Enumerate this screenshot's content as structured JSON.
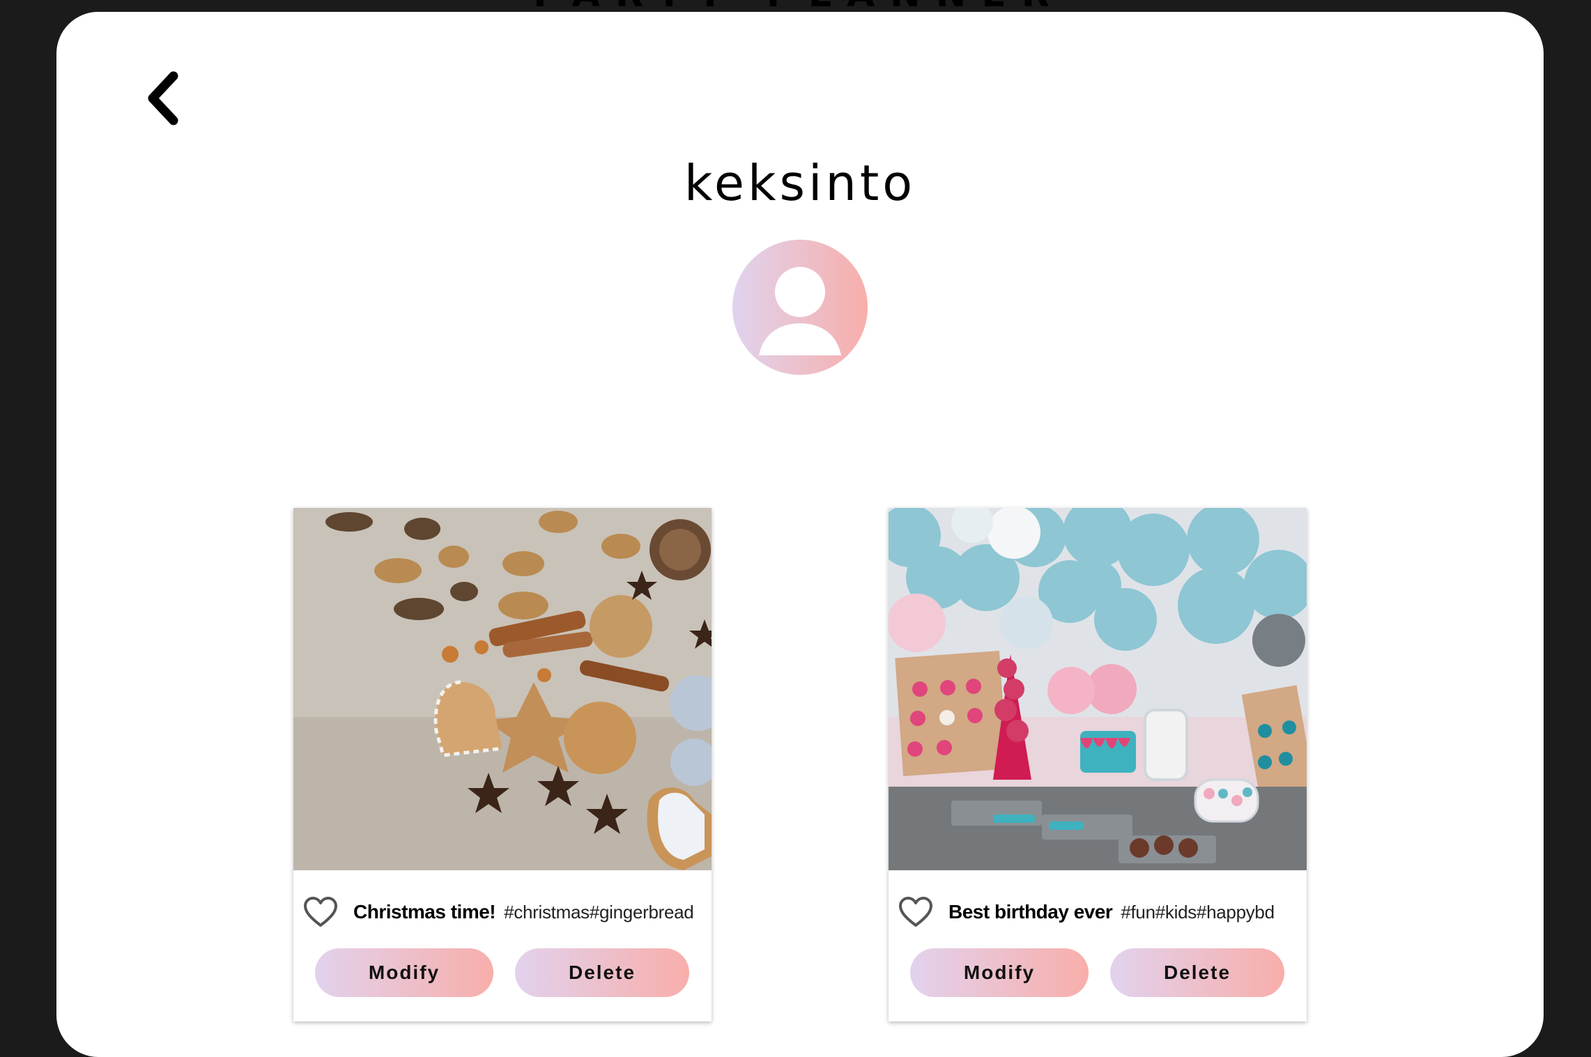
{
  "app": {
    "brand": "PARTY PLANNER"
  },
  "profile": {
    "username": "keksinto"
  },
  "posts": [
    {
      "title": "Christmas time!",
      "tags": "#christmas#gingerbread",
      "modify_label": "Modify",
      "delete_label": "Delete"
    },
    {
      "title": "Best birthday ever",
      "tags": "#fun#kids#happybd",
      "modify_label": "Modify",
      "delete_label": "Delete"
    }
  ],
  "colors": {
    "background": "#1b1b1b",
    "panel": "#ffffff",
    "gradient_start": "#e0d3ee",
    "gradient_end": "#f8aeaa"
  },
  "icons": {
    "back": "chevron-left-icon",
    "avatar": "user-icon",
    "like": "heart-outline-icon"
  }
}
